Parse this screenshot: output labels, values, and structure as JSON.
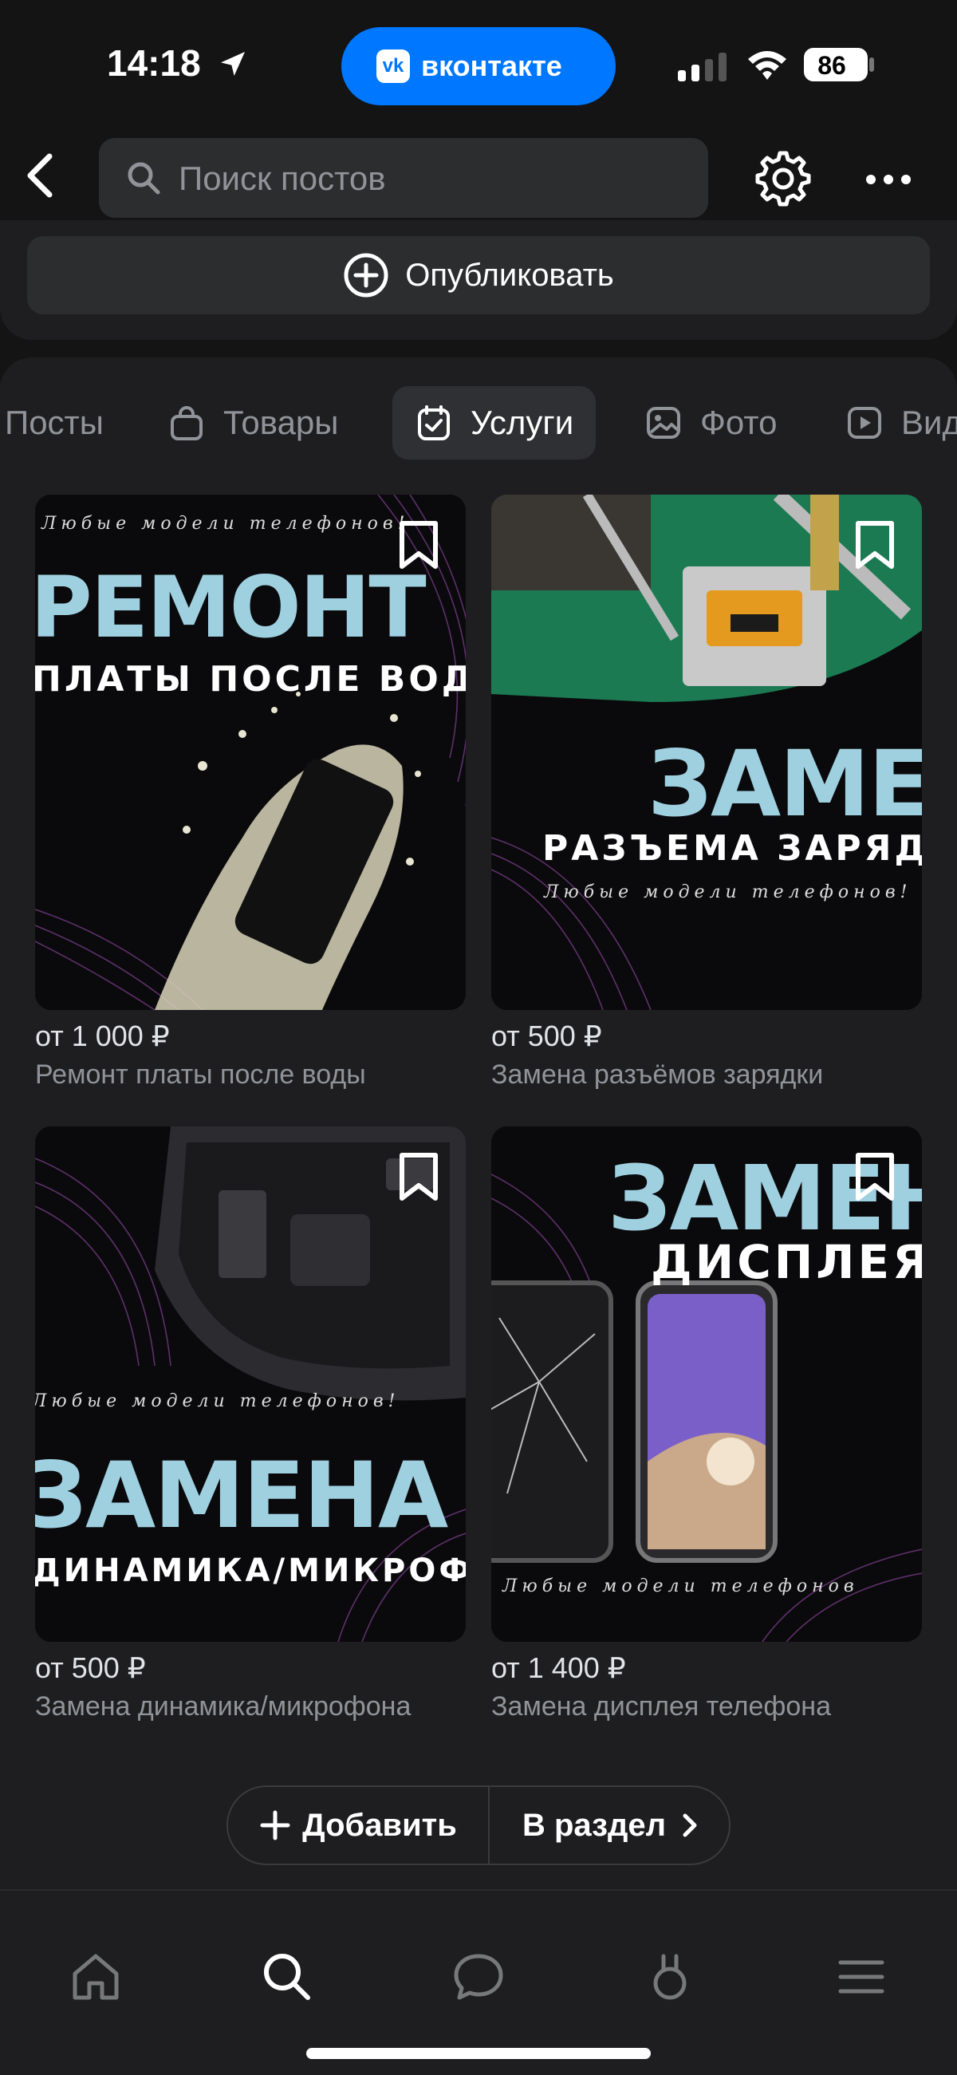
{
  "status_bar": {
    "time": "14:18",
    "app_pill_label": "вконтакте",
    "app_logo_text": "vk",
    "battery": "86"
  },
  "nav": {
    "search_placeholder": "Поиск постов"
  },
  "publish": {
    "label": "Опубликовать"
  },
  "tabs": [
    {
      "label": "Посты",
      "icon": "none",
      "active": false
    },
    {
      "label": "Товары",
      "icon": "shopping-bag-icon",
      "active": false
    },
    {
      "label": "Услуги",
      "icon": "calendar-check-icon",
      "active": true
    },
    {
      "label": "Фото",
      "icon": "photo-icon",
      "active": false
    },
    {
      "label": "Вид",
      "icon": "video-icon",
      "active": false
    }
  ],
  "services": [
    {
      "price": "от 1 000 ₽",
      "title": "Ремонт платы после воды",
      "art": {
        "script": "Любые модели телефонов!",
        "big": "РЕМОНТ",
        "sub": "ПЛАТЫ ПОСЛЕ ВОДЫ"
      }
    },
    {
      "price": "от 500 ₽",
      "title": "Замена разъёмов зарядки",
      "art": {
        "big": "ЗАМЕНА",
        "sub": "РАЗЪЕМА ЗАРЯДКИ",
        "script": "Любые модели телефонов!"
      }
    },
    {
      "price": "от 500 ₽",
      "title": "Замена динамика/микрофона",
      "art": {
        "script": "Любые модели телефонов!",
        "big": "ЗАМЕНА",
        "sub": "ДИНАМИКА/МИКРОФОН"
      }
    },
    {
      "price": "от 1 400 ₽",
      "title": "Замена дисплея телефона",
      "art": {
        "big": "ЗАМЕНА",
        "sub": "ДИСПЛЕЯ",
        "script": "Любые модели телефонов"
      }
    }
  ],
  "actions": {
    "add_label": "Добавить",
    "section_label": "В раздел"
  },
  "colors": {
    "accent": "#0077ff",
    "background": "#141414",
    "card": "#1e1e20",
    "art_blue": "#9fd0e0"
  },
  "tabbar": [
    "home-icon",
    "search-icon",
    "messages-icon",
    "clips-icon",
    "menu-icon"
  ]
}
